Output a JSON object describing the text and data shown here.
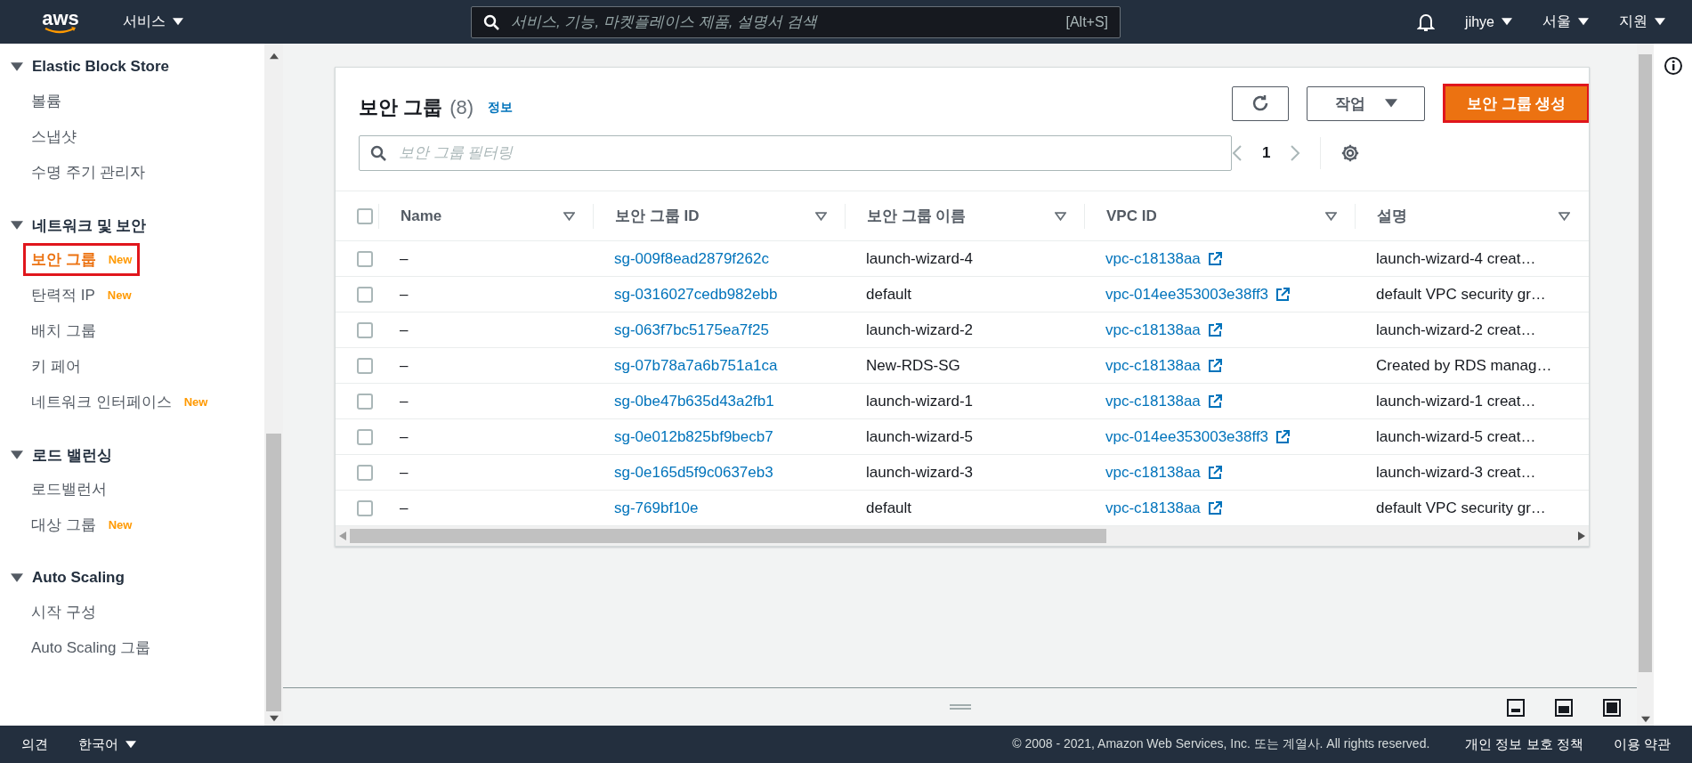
{
  "top_bar": {
    "logo": "aws",
    "services": "서비스",
    "search": {
      "placeholder": "서비스, 기능, 마켓플레이스 제품, 설명서 검색",
      "shortcut": "[Alt+S]"
    },
    "menus": [
      "jihye",
      "서울",
      "지원"
    ]
  },
  "sidebar": {
    "sections": [
      {
        "title": "Elastic Block Store",
        "expanded": true,
        "items": [
          {
            "label": "볼륨",
            "selected": false,
            "highlighted": false
          },
          {
            "label": "스냅샷",
            "selected": false,
            "highlighted": false
          },
          {
            "label": "수명 주기 관리자",
            "selected": false,
            "highlighted": false
          }
        ]
      },
      {
        "title": "네트워크 및 보안",
        "expanded": true,
        "items": [
          {
            "label": "보안 그룹",
            "badge": "New",
            "selected": true,
            "highlighted": true
          },
          {
            "label": "탄력적 IP",
            "badge": "New",
            "selected": false,
            "highlighted": false
          },
          {
            "label": "배치 그룹",
            "selected": false,
            "highlighted": false
          },
          {
            "label": "키 페어",
            "selected": false,
            "highlighted": false
          },
          {
            "label": "네트워크 인터페이스",
            "badge": "New",
            "selected": false,
            "highlighted": false
          }
        ]
      },
      {
        "title": "로드 밸런싱",
        "expanded": true,
        "items": [
          {
            "label": "로드밸런서",
            "selected": false,
            "highlighted": false
          },
          {
            "label": "대상 그룹",
            "badge": "New",
            "selected": false,
            "highlighted": false
          }
        ]
      },
      {
        "title": "Auto Scaling",
        "expanded": true,
        "items": [
          {
            "label": "시작 구성",
            "selected": false,
            "highlighted": false
          },
          {
            "label": "Auto Scaling 그룹",
            "selected": false,
            "highlighted": false
          }
        ]
      }
    ]
  },
  "panel": {
    "title": "보안 그룹",
    "count": "(8)",
    "info_link": "정보",
    "actions_button": "작업",
    "create_button": {
      "label": "보안 그룹 생성",
      "highlighted": true
    },
    "filter": {
      "placeholder": "보안 그룹 필터링"
    },
    "page": "1",
    "select_all_checked": false,
    "table": {
      "columns": [
        "Name",
        "보안 그룹 ID",
        "보안 그룹 이름",
        "VPC ID",
        "설명"
      ],
      "rows": [
        {
          "checked": false,
          "name": "–",
          "id": "sg-009f8ead2879f262c",
          "group_name": "launch-wizard-4",
          "vpc": "vpc-c18138aa",
          "description": "launch-wizard-4 creat…"
        },
        {
          "checked": false,
          "name": "–",
          "id": "sg-0316027cedb982ebb",
          "group_name": "default",
          "vpc": "vpc-014ee353003e38ff3",
          "description": "default VPC security gr…"
        },
        {
          "checked": false,
          "name": "–",
          "id": "sg-063f7bc5175ea7f25",
          "group_name": "launch-wizard-2",
          "vpc": "vpc-c18138aa",
          "description": "launch-wizard-2 creat…"
        },
        {
          "checked": false,
          "name": "–",
          "id": "sg-07b78a7a6b751a1ca",
          "group_name": "New-RDS-SG",
          "vpc": "vpc-c18138aa",
          "description": "Created by RDS manag…"
        },
        {
          "checked": false,
          "name": "–",
          "id": "sg-0be47b635d43a2fb1",
          "group_name": "launch-wizard-1",
          "vpc": "vpc-c18138aa",
          "description": "launch-wizard-1 creat…"
        },
        {
          "checked": false,
          "name": "–",
          "id": "sg-0e012b825bf9becb7",
          "group_name": "launch-wizard-5",
          "vpc": "vpc-014ee353003e38ff3",
          "description": "launch-wizard-5 creat…"
        },
        {
          "checked": false,
          "name": "–",
          "id": "sg-0e165d5f9c0637eb3",
          "group_name": "launch-wizard-3",
          "vpc": "vpc-c18138aa",
          "description": "launch-wizard-3 creat…"
        },
        {
          "checked": false,
          "name": "–",
          "id": "sg-769bf10e",
          "group_name": "default",
          "vpc": "vpc-c18138aa",
          "description": "default VPC security gr…"
        }
      ]
    }
  },
  "footer": {
    "feedback": "의견",
    "language": "한국어",
    "copyright": "© 2008 - 2021, Amazon Web Services, Inc. 또는 계열사. All rights reserved.",
    "links": [
      "개인 정보 보호 정책",
      "이용 약관"
    ]
  }
}
